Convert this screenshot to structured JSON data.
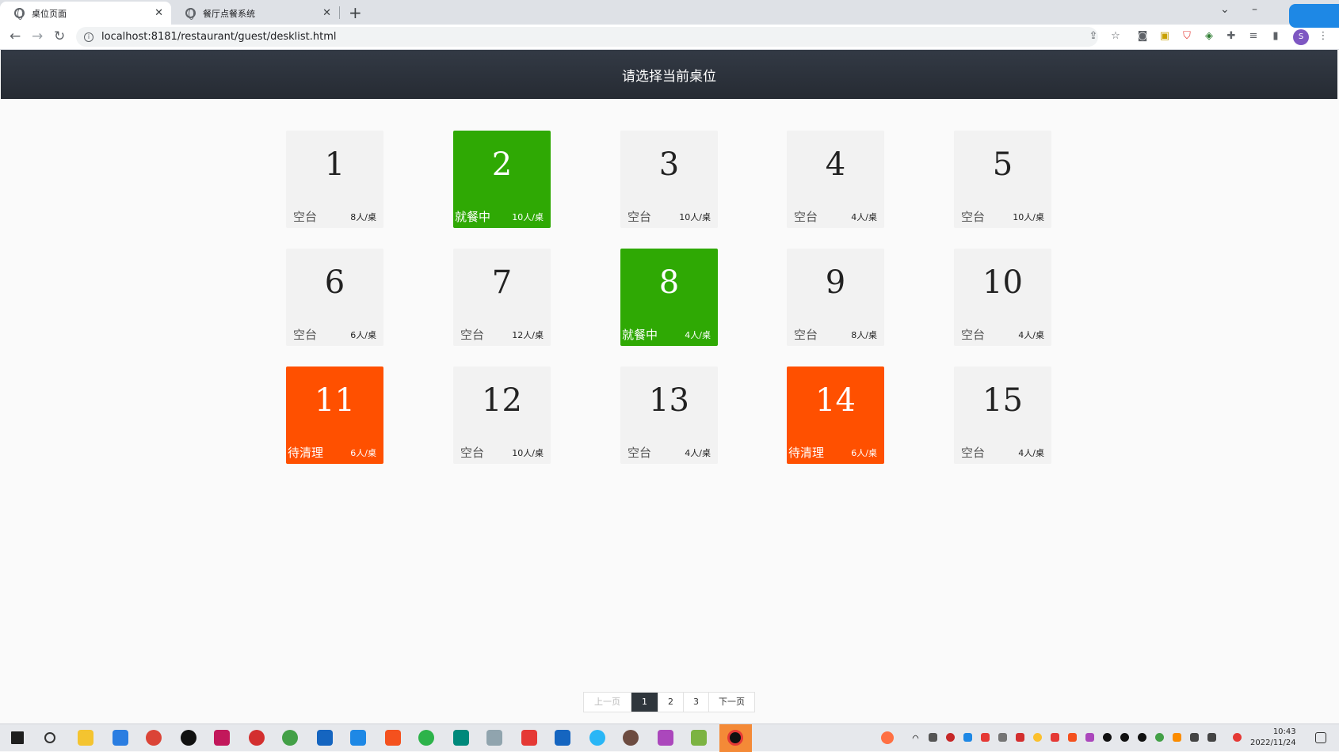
{
  "browser": {
    "tabs": [
      {
        "title": "桌位页面",
        "active": true
      },
      {
        "title": "餐厅点餐系统",
        "active": false
      }
    ],
    "url": "localhost:8181/restaurant/guest/desklist.html",
    "profile_initial": "S"
  },
  "page": {
    "header_title": "请选择当前桌位"
  },
  "colors": {
    "empty": "#f2f2f2",
    "dining": "#2fa904",
    "cleaning": "#ff5000",
    "header": "#2b313a"
  },
  "desks": [
    {
      "number": "1",
      "status": "空台",
      "capacity": "8人/桌",
      "kind": "empty"
    },
    {
      "number": "2",
      "status": "就餐中",
      "capacity": "10人/桌",
      "kind": "busy"
    },
    {
      "number": "3",
      "status": "空台",
      "capacity": "10人/桌",
      "kind": "empty"
    },
    {
      "number": "4",
      "status": "空台",
      "capacity": "4人/桌",
      "kind": "empty"
    },
    {
      "number": "5",
      "status": "空台",
      "capacity": "10人/桌",
      "kind": "empty"
    },
    {
      "number": "6",
      "status": "空台",
      "capacity": "6人/桌",
      "kind": "empty"
    },
    {
      "number": "7",
      "status": "空台",
      "capacity": "12人/桌",
      "kind": "empty"
    },
    {
      "number": "8",
      "status": "就餐中",
      "capacity": "4人/桌",
      "kind": "busy"
    },
    {
      "number": "9",
      "status": "空台",
      "capacity": "8人/桌",
      "kind": "empty"
    },
    {
      "number": "10",
      "status": "空台",
      "capacity": "4人/桌",
      "kind": "empty"
    },
    {
      "number": "11",
      "status": "待清理",
      "capacity": "6人/桌",
      "kind": "dirty"
    },
    {
      "number": "12",
      "status": "空台",
      "capacity": "10人/桌",
      "kind": "empty"
    },
    {
      "number": "13",
      "status": "空台",
      "capacity": "4人/桌",
      "kind": "empty"
    },
    {
      "number": "14",
      "status": "待清理",
      "capacity": "6人/桌",
      "kind": "dirty"
    },
    {
      "number": "15",
      "status": "空台",
      "capacity": "4人/桌",
      "kind": "empty"
    }
  ],
  "pagination": {
    "prev": "上一页",
    "pages": [
      "1",
      "2",
      "3"
    ],
    "current": "1",
    "next": "下一页"
  },
  "taskbar": {
    "time": "10:43",
    "date": "2022/11/24"
  }
}
